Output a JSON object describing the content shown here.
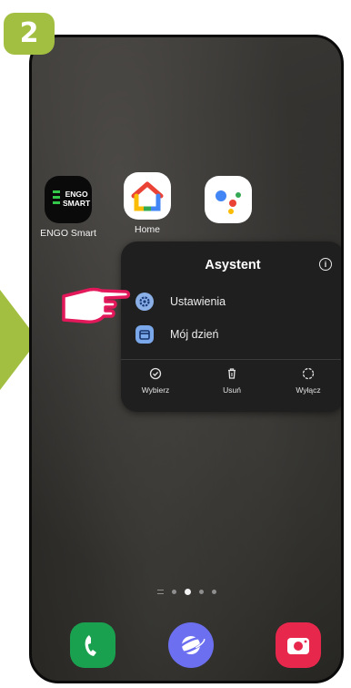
{
  "step": {
    "number": "2"
  },
  "colors": {
    "accent_green": "#a3bf42",
    "hand_pink": "#e3185b",
    "phone_icon": "#1aa150",
    "internet_icon": "#6b6ff0",
    "camera_icon": "#e8274d"
  },
  "home": {
    "apps": [
      {
        "icon": "engo-smart-icon",
        "label": "ENGO Smart",
        "logo_text": [
          "ENGO",
          "SMART"
        ]
      },
      {
        "icon": "google-home-icon",
        "label": "Home"
      },
      {
        "icon": "google-assistant-icon",
        "label": ""
      }
    ],
    "page_indicator": {
      "pages": 4,
      "active_index": 1
    }
  },
  "popup": {
    "title": "Asystent",
    "info_icon": "info-icon",
    "items": [
      {
        "label": "Ustawienia",
        "icon": "settings-gear-icon"
      },
      {
        "label": "Mój dzień",
        "icon": "calendar-icon"
      }
    ],
    "actions": [
      {
        "label": "Wybierz",
        "icon": "check-circle-icon"
      },
      {
        "label": "Usuń",
        "icon": "trash-icon"
      },
      {
        "label": "Wyłącz",
        "icon": "dashed-circle-icon"
      }
    ]
  },
  "dock": [
    {
      "icon": "phone-icon"
    },
    {
      "icon": "internet-icon"
    },
    {
      "icon": "camera-icon"
    }
  ]
}
